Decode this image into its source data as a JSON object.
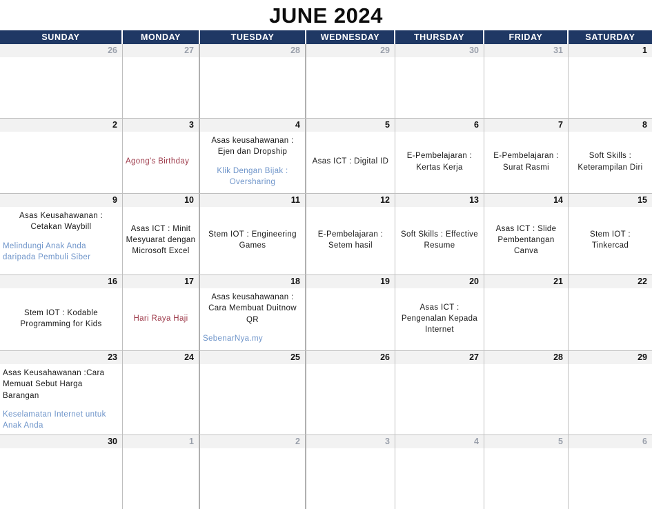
{
  "header": {
    "title": "JUNE 2024",
    "weekdays": [
      "SUNDAY",
      "MONDAY",
      "TUESDAY",
      "WEDNESDAY",
      "THURSDAY",
      "FRIDAY",
      "SATURDAY"
    ]
  },
  "colors": {
    "header_band": "#1f3864",
    "daynum_band": "#f2f2f2",
    "grid_line": "#bfbfbf",
    "event_default": "#1a1a1a",
    "event_blue": "#6f95ca",
    "event_red": "#9e3b4b",
    "outside_daynum": "#9aa0ab"
  },
  "weeks": [
    {
      "days": [
        {
          "num": "26",
          "outside": true,
          "events": []
        },
        {
          "num": "27",
          "outside": true,
          "events": []
        },
        {
          "num": "28",
          "outside": true,
          "events": []
        },
        {
          "num": "29",
          "outside": true,
          "events": []
        },
        {
          "num": "30",
          "outside": true,
          "events": []
        },
        {
          "num": "31",
          "outside": true,
          "events": []
        },
        {
          "num": "1",
          "outside": false,
          "events": []
        }
      ]
    },
    {
      "days": [
        {
          "num": "2",
          "outside": false,
          "events": []
        },
        {
          "num": "3",
          "outside": false,
          "events": [
            {
              "text": "Agong's Birthday",
              "color": "red",
              "align": "left"
            }
          ]
        },
        {
          "num": "4",
          "outside": false,
          "events": [
            {
              "text": "Asas keusahawanan : Ejen dan Dropship",
              "color": "default",
              "align": "center"
            },
            {
              "text": "Klik Dengan Bijak : Oversharing",
              "color": "blue",
              "align": "center"
            }
          ]
        },
        {
          "num": "5",
          "outside": false,
          "events": [
            {
              "text": "Asas ICT : Digital  ID",
              "color": "default",
              "align": "center"
            }
          ]
        },
        {
          "num": "6",
          "outside": false,
          "events": [
            {
              "text": "E-Pembelajaran : Kertas Kerja",
              "color": "default",
              "align": "center"
            }
          ]
        },
        {
          "num": "7",
          "outside": false,
          "events": [
            {
              "text": "E-Pembelajaran : Surat Rasmi",
              "color": "default",
              "align": "center"
            }
          ]
        },
        {
          "num": "8",
          "outside": false,
          "events": [
            {
              "text": "Soft Skills : Keterampilan Diri",
              "color": "default",
              "align": "center"
            }
          ]
        }
      ]
    },
    {
      "days": [
        {
          "num": "9",
          "outside": false,
          "events": [
            {
              "text": "Asas Keusahawanan : Cetakan Waybill",
              "color": "default",
              "align": "center"
            },
            {
              "text": "Melindungi Anak Anda daripada Pembuli Siber",
              "color": "blue",
              "align": "left"
            }
          ]
        },
        {
          "num": "10",
          "outside": false,
          "events": [
            {
              "text": "Asas ICT : Minit Mesyuarat dengan Microsoft Excel",
              "color": "default",
              "align": "center"
            }
          ]
        },
        {
          "num": "11",
          "outside": false,
          "events": [
            {
              "text": "Stem IOT : Engineering Games",
              "color": "default",
              "align": "center"
            }
          ]
        },
        {
          "num": "12",
          "outside": false,
          "events": [
            {
              "text": "E-Pembelajaran : Setem hasil",
              "color": "default",
              "align": "center"
            }
          ]
        },
        {
          "num": "13",
          "outside": false,
          "events": [
            {
              "text": "Soft Skills : Effective Resume",
              "color": "default",
              "align": "center"
            }
          ]
        },
        {
          "num": "14",
          "outside": false,
          "events": [
            {
              "text": "Asas ICT : Slide Pembentangan Canva",
              "color": "default",
              "align": "center"
            }
          ]
        },
        {
          "num": "15",
          "outside": false,
          "events": [
            {
              "text": "Stem IOT : Tinkercad",
              "color": "default",
              "align": "center"
            }
          ]
        }
      ]
    },
    {
      "days": [
        {
          "num": "16",
          "outside": false,
          "events": [
            {
              "text": "Stem IOT : Kodable Programming for Kids",
              "color": "default",
              "align": "center"
            }
          ]
        },
        {
          "num": "17",
          "outside": false,
          "events": [
            {
              "text": "Hari Raya Haji",
              "color": "red",
              "align": "center"
            }
          ]
        },
        {
          "num": "18",
          "outside": false,
          "events": [
            {
              "text": "Asas keusahawanan : Cara Membuat Duitnow QR",
              "color": "default",
              "align": "center"
            },
            {
              "text": "SebenarNya.my",
              "color": "blue",
              "align": "left"
            }
          ]
        },
        {
          "num": "19",
          "outside": false,
          "events": []
        },
        {
          "num": "20",
          "outside": false,
          "events": [
            {
              "text": "Asas ICT : Pengenalan Kepada Internet",
              "color": "default",
              "align": "center"
            }
          ]
        },
        {
          "num": "21",
          "outside": false,
          "events": []
        },
        {
          "num": "22",
          "outside": false,
          "events": []
        }
      ]
    },
    {
      "days": [
        {
          "num": "23",
          "outside": false,
          "events": [
            {
              "text": "Asas Keusahawanan :Cara Memuat Sebut Harga Barangan",
              "color": "default",
              "align": "left"
            },
            {
              "text": "Keselamatan Internet untuk Anak Anda",
              "color": "blue",
              "align": "left"
            }
          ]
        },
        {
          "num": "24",
          "outside": false,
          "events": []
        },
        {
          "num": "25",
          "outside": false,
          "events": []
        },
        {
          "num": "26",
          "outside": false,
          "events": []
        },
        {
          "num": "27",
          "outside": false,
          "events": []
        },
        {
          "num": "28",
          "outside": false,
          "events": []
        },
        {
          "num": "29",
          "outside": false,
          "events": []
        }
      ]
    },
    {
      "days": [
        {
          "num": "30",
          "outside": false,
          "events": []
        },
        {
          "num": "1",
          "outside": true,
          "events": []
        },
        {
          "num": "2",
          "outside": true,
          "events": []
        },
        {
          "num": "3",
          "outside": true,
          "events": []
        },
        {
          "num": "4",
          "outside": true,
          "events": []
        },
        {
          "num": "5",
          "outside": true,
          "events": []
        },
        {
          "num": "6",
          "outside": true,
          "events": []
        }
      ]
    }
  ]
}
